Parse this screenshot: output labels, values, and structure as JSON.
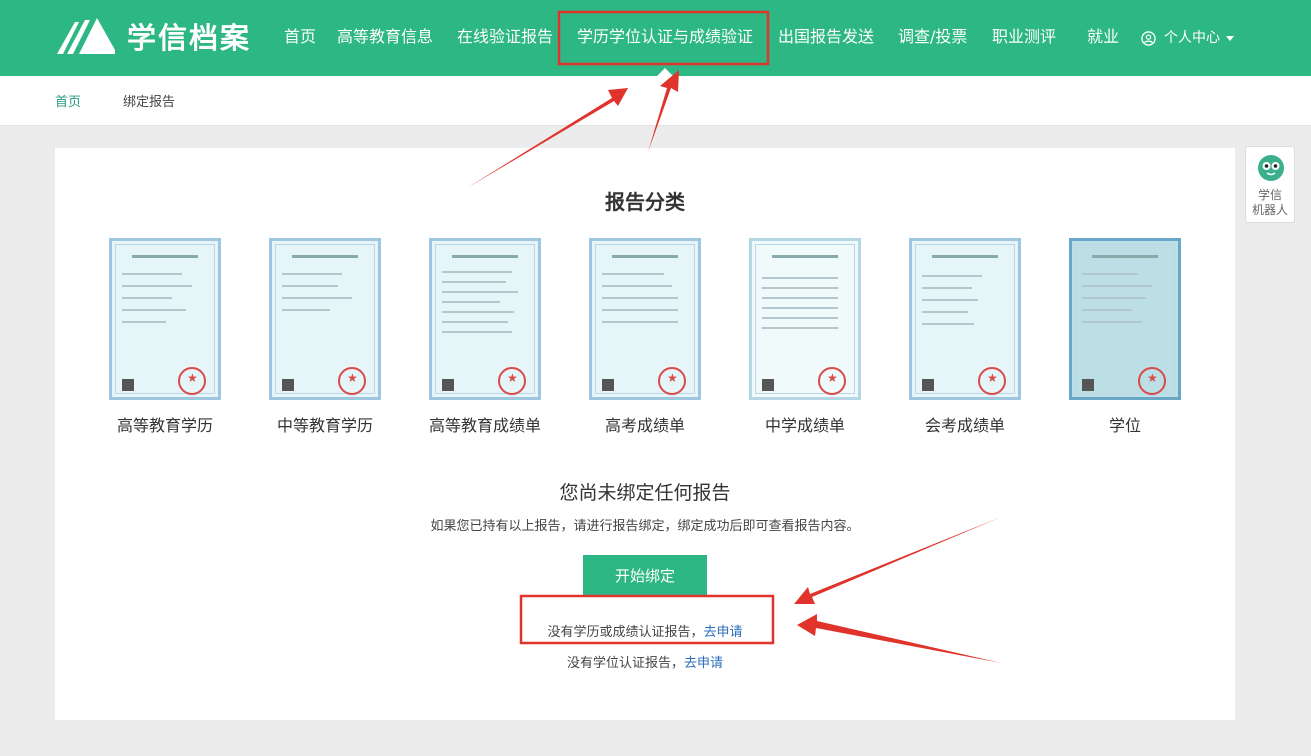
{
  "header": {
    "logo_text": "学信档案",
    "nav": [
      {
        "label": "首页"
      },
      {
        "label": "高等教育信息"
      },
      {
        "label": "在线验证报告"
      },
      {
        "label": "学历学位认证与成绩验证"
      },
      {
        "label": "出国报告发送"
      },
      {
        "label": "调查/投票"
      },
      {
        "label": "职业测评"
      },
      {
        "label": "就业"
      }
    ],
    "user_menu": "个人中心"
  },
  "breadcrumb": {
    "home": "首页",
    "current": "绑定报告"
  },
  "main": {
    "section_title": "报告分类",
    "reports": [
      {
        "label": "高等教育学历"
      },
      {
        "label": "中等教育学历"
      },
      {
        "label": "高等教育成绩单"
      },
      {
        "label": "高考成绩单"
      },
      {
        "label": "中学成绩单"
      },
      {
        "label": "会考成绩单"
      },
      {
        "label": "学位"
      }
    ],
    "empty_title": "您尚未绑定任何报告",
    "empty_desc": "如果您已持有以上报告，请进行报告绑定，绑定成功后即可查看报告内容。",
    "bind_button": "开始绑定",
    "no_edu_report": "没有学历或成绩认证报告，",
    "no_edu_link": "去申请",
    "no_degree_report": "没有学位认证报告，",
    "no_degree_link": "去申请"
  },
  "robot": {
    "line1": "学信",
    "line2": "机器人"
  },
  "colors": {
    "brand": "#2db784",
    "link": "#2a6ebb",
    "annotation": "#e0332b"
  }
}
